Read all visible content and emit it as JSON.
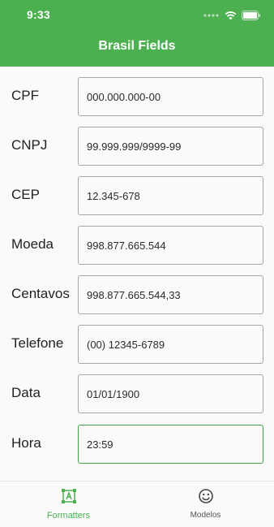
{
  "status_bar": {
    "time": "9:33",
    "icons": [
      "signal-dots-icon",
      "wifi-icon",
      "battery-icon"
    ]
  },
  "appbar": {
    "title": "Brasil Fields",
    "color": "#4caf50"
  },
  "fields": [
    {
      "label": "CPF",
      "value": "000.000.000-00"
    },
    {
      "label": "CNPJ",
      "value": "99.999.999/9999-99"
    },
    {
      "label": "CEP",
      "value": "12.345-678"
    },
    {
      "label": "Moeda",
      "value": "998.877.665.544"
    },
    {
      "label": "Centavos",
      "value": "998.877.665.544,33"
    },
    {
      "label": "Telefone",
      "value": "(00) 12345-6789"
    },
    {
      "label": "Data",
      "value": "01/01/1900"
    },
    {
      "label": "Hora",
      "value": "23:59",
      "focused": true
    }
  ],
  "bottom_nav": {
    "items": [
      {
        "label": "Formatters",
        "icon": "text-frame-icon",
        "active": true
      },
      {
        "label": "Modelos",
        "icon": "smiley-icon",
        "active": false
      }
    ],
    "active_color": "#4caf50"
  }
}
